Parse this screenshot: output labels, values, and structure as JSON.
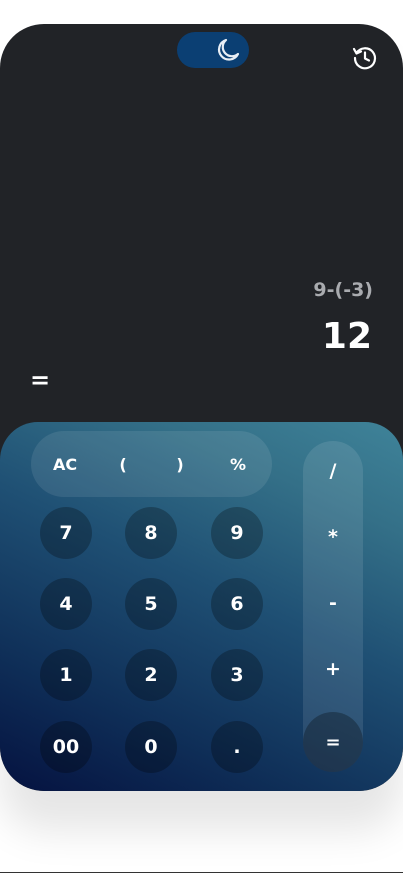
{
  "header": {
    "theme_toggle_icon": "moon-icon",
    "history_icon": "history-icon"
  },
  "display": {
    "expression": "9-(-3)",
    "result": "12",
    "equals_sign": "="
  },
  "keypad": {
    "top_row": [
      "AC",
      "(",
      ")",
      "%"
    ],
    "numbers": [
      [
        "7",
        "8",
        "9"
      ],
      [
        "4",
        "5",
        "6"
      ],
      [
        "1",
        "2",
        "3"
      ],
      [
        "00",
        "0",
        "."
      ]
    ],
    "operators": [
      "/",
      "*",
      "-",
      "+"
    ],
    "equals": "="
  },
  "colors": {
    "background": "#212327",
    "toggle": "#0b3f73",
    "keypad_gradient_start": "#051240",
    "keypad_gradient_end": "#3f8399"
  }
}
